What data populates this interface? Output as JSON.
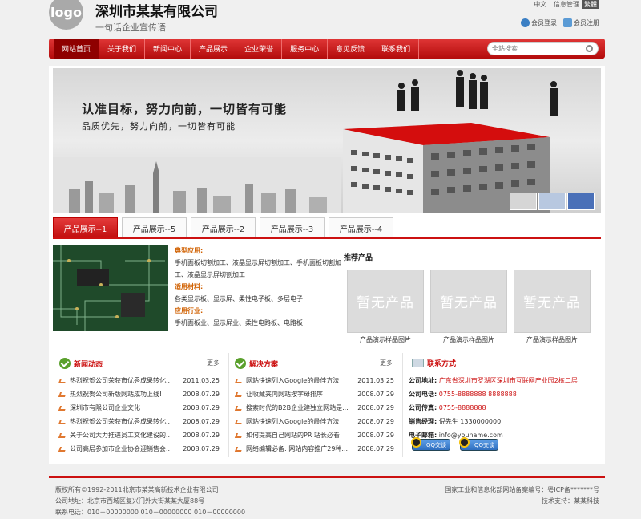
{
  "header": {
    "logo_text": "logo",
    "company": "深圳市某某有限公司",
    "slogan": "一句话企业宣传语",
    "lang_cn": "中文",
    "info_mgmt": "信息管理",
    "lang_trad": "繁體",
    "login": "会员登录",
    "register": "会员注册"
  },
  "nav": {
    "items": [
      "网站首页",
      "关于我们",
      "新闻中心",
      "产品展示",
      "企业荣誉",
      "服务中心",
      "意见反馈",
      "联系我们"
    ],
    "search_placeholder": "全站搜索"
  },
  "banner": {
    "headline": "认准目标，努力向前，一切皆有可能",
    "subline": "品质优先，努力向前，一切皆有可能"
  },
  "product_tabs": [
    "产品展示--1",
    "产品展示--5",
    "产品展示--2",
    "产品展示--3",
    "产品展示--4"
  ],
  "product": {
    "h1": "典型应用:",
    "t1": "手机面板切割加工、液晶显示屏切割加工、手机面板切割加工、液晶显示屏切割加工",
    "h2": "适用材料:",
    "t2": "各类显示板、显示屏、柔性电子板、多层电子",
    "h3": "应用行业:",
    "t3": "手机面板业、显示屏业、柔性电路板、电路板"
  },
  "recommend": {
    "title": "推荐产品",
    "items": [
      {
        "placeholder": "暂无产品",
        "caption": "产品演示样品图片"
      },
      {
        "placeholder": "暂无产品",
        "caption": "产品演示样品图片"
      },
      {
        "placeholder": "暂无产品",
        "caption": "产品演示样品图片"
      }
    ]
  },
  "news": {
    "title": "新闻动态",
    "more": "更多",
    "items": [
      {
        "title": "热烈祝贺公司荣获市优秀成果转化...",
        "date": "2011.03.25"
      },
      {
        "title": "热烈祝贺公司新版网站成功上线!",
        "date": "2008.07.29"
      },
      {
        "title": "深圳市有限公司企业文化",
        "date": "2008.07.29"
      },
      {
        "title": "热烈祝贺公司荣获市优秀成果转化...",
        "date": "2008.07.29"
      },
      {
        "title": "关于公司大力推进员工文化建设的...",
        "date": "2008.07.29"
      },
      {
        "title": "公司高层参加市企业协会迎销售会...",
        "date": "2008.07.29"
      }
    ]
  },
  "solutions": {
    "title": "解决方案",
    "more": "更多",
    "items": [
      {
        "title": "网站快速列入Google的最佳方法",
        "date": "2011.03.25"
      },
      {
        "title": "让收藏夹内网站按字母排序",
        "date": "2008.07.29"
      },
      {
        "title": "搜索时代的B2B企业建独立网站是...",
        "date": "2008.07.29"
      },
      {
        "title": "网站快速列入Google的最佳方法",
        "date": "2008.07.29"
      },
      {
        "title": "如何提高自己网站的PR 站长必看",
        "date": "2008.07.29"
      },
      {
        "title": "网络编辑必备: 网站内容推广29种...",
        "date": "2008.07.29"
      }
    ]
  },
  "contact": {
    "title": "联系方式",
    "address_label": "公司地址:",
    "address": "广东省深圳市罗湖区深圳市互联网产业园2栋二层",
    "phone_label": "公司电话:",
    "phone": "0755-8888888 8888888",
    "fax_label": "公司传真:",
    "fax": "0755-8888888",
    "manager_label": "销售经理:",
    "manager": "倪先生 1330000000",
    "email_label": "电子邮箱:",
    "email": "info@youname.com",
    "qq1": "QQ交谈",
    "qq2": "QQ交谈"
  },
  "footer": {
    "copyright": "版权所有©1992-2011北京市某某高新技术企业有限公司",
    "address": "公司地址：北京市西城区复兴门外大街某某大厦88号",
    "phone": "联系电话：010－00000000 010－00000000 010－00000000",
    "icp": "国家工业和信息化部网站备案编号：粤ICP备*******号",
    "support": "技术支持：某某科技"
  },
  "colors": {
    "brand_red": "#cc1111",
    "nav_red": "#d42020",
    "orange_head": "#d06000"
  }
}
